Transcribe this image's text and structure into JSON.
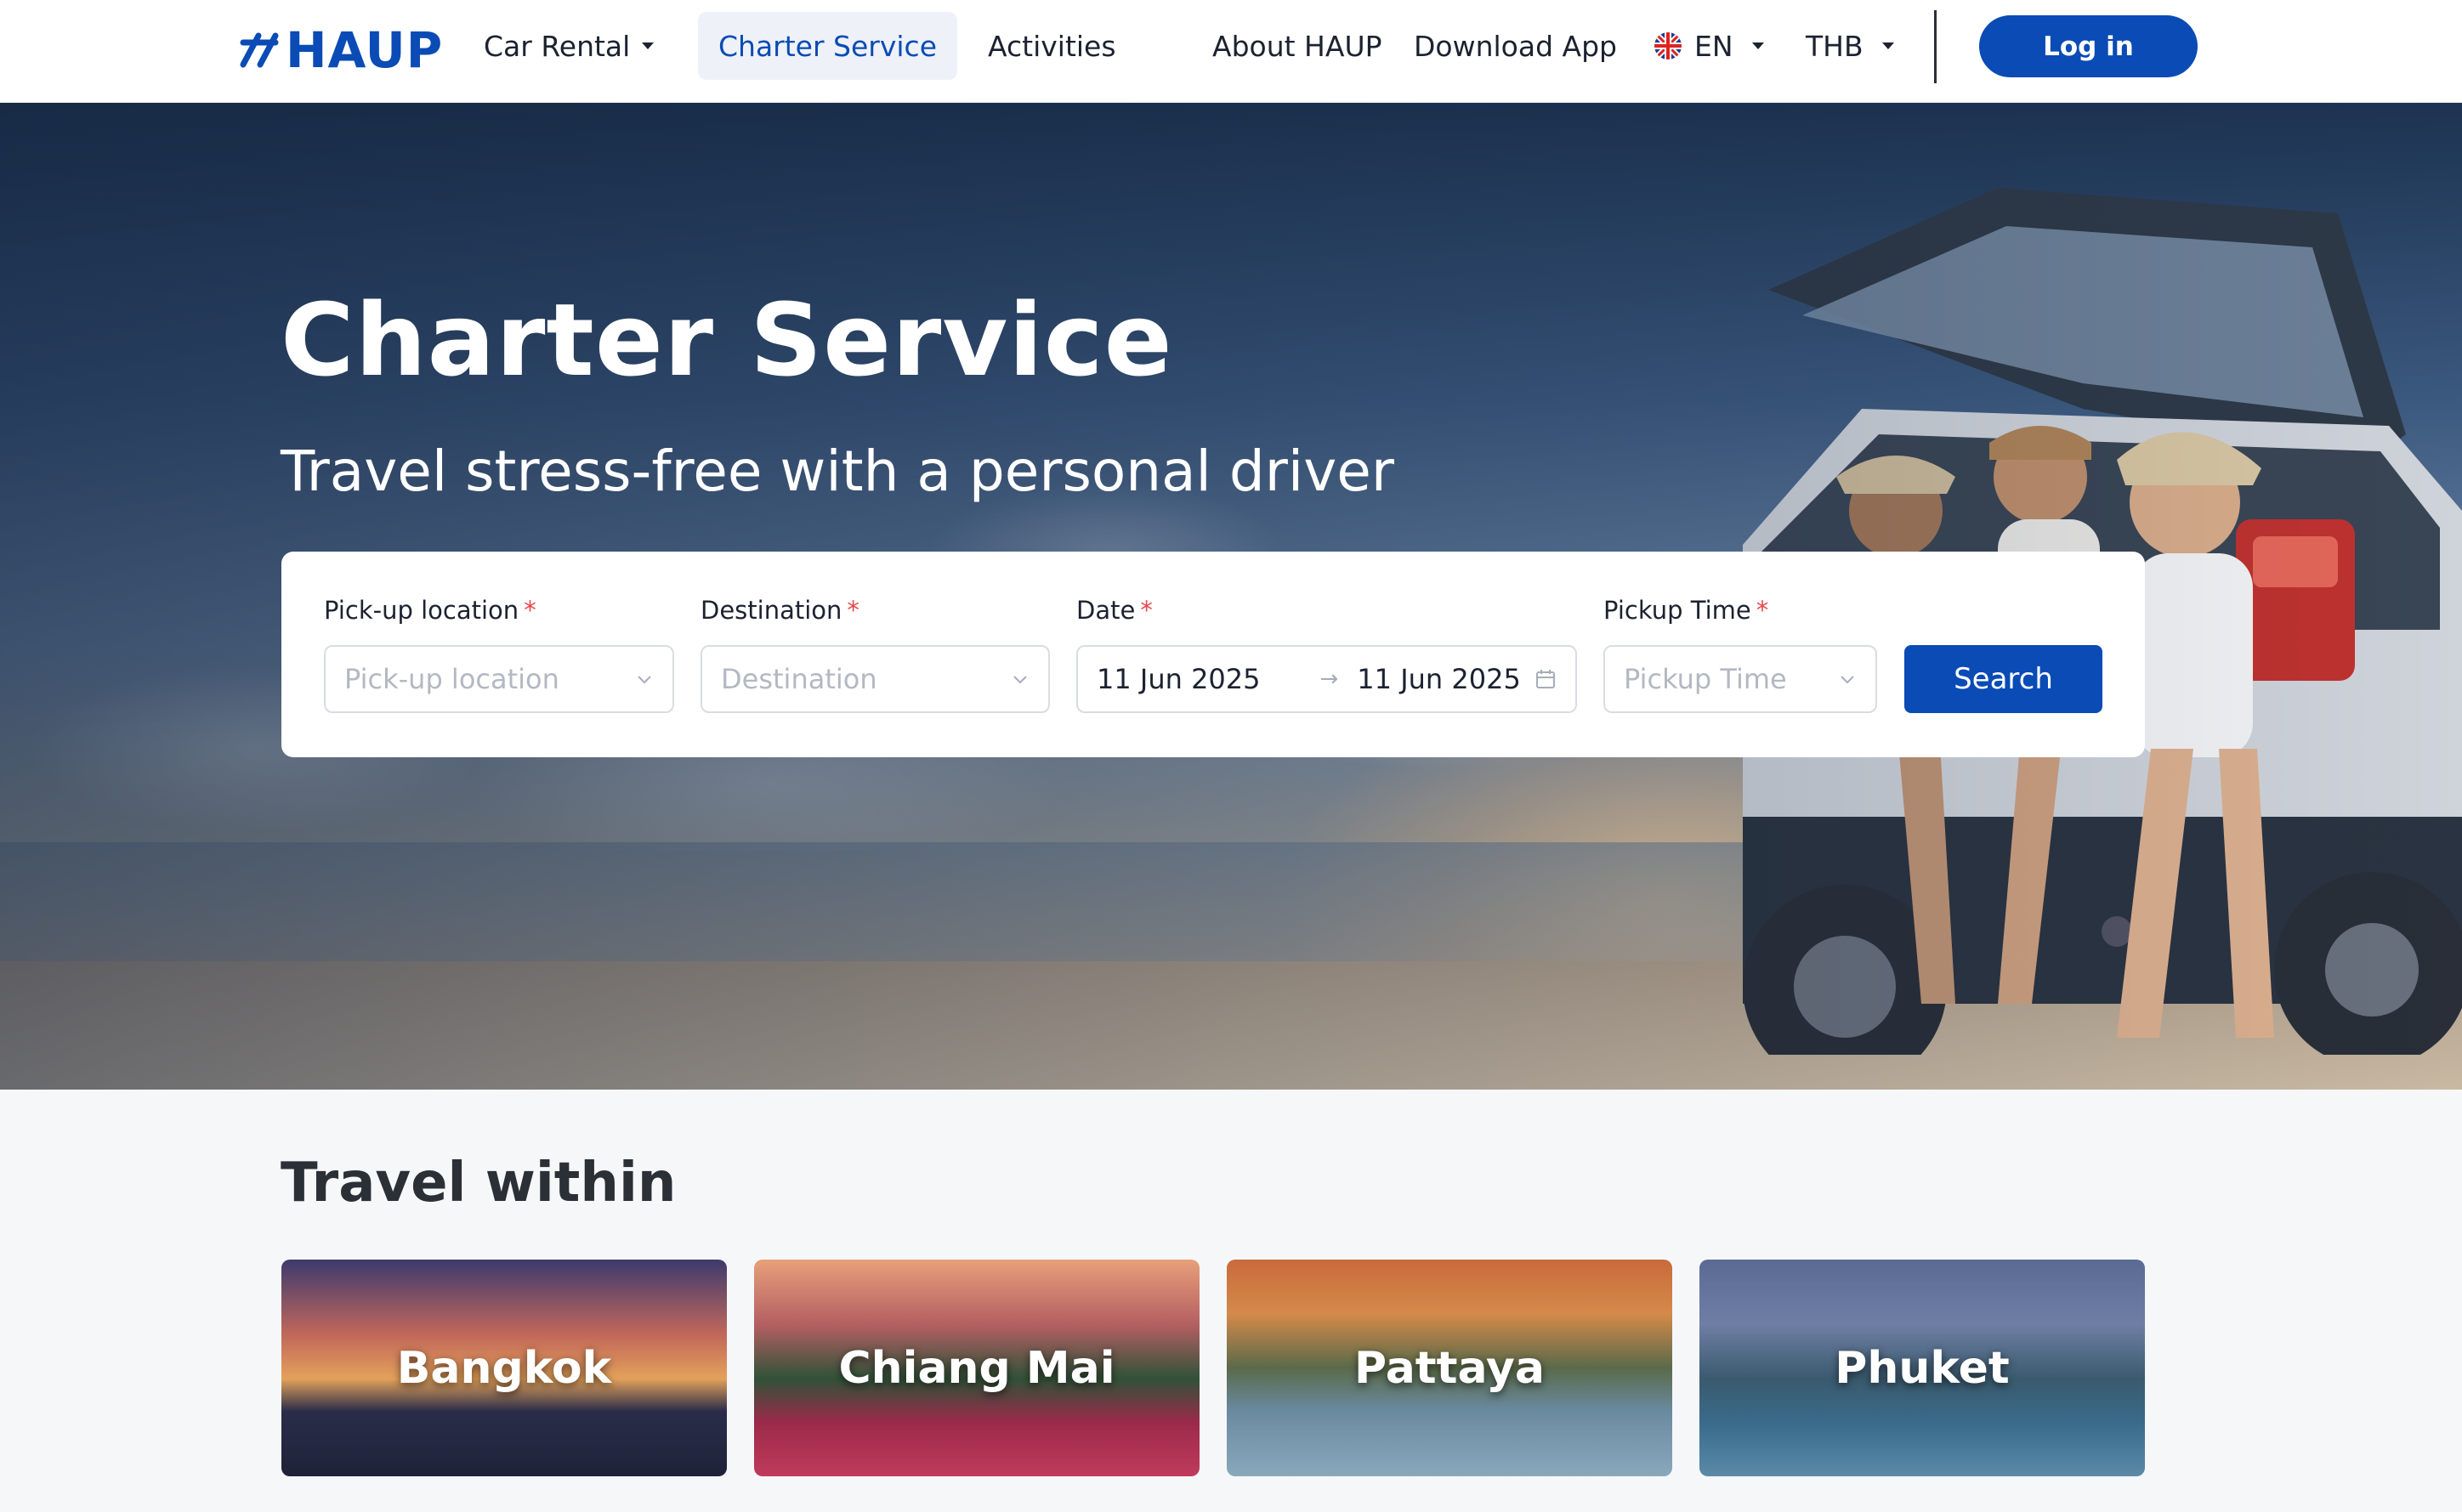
{
  "nav": {
    "brand": "HAUP",
    "items": [
      {
        "label": "Car Rental",
        "has_dropdown": true,
        "active": false
      },
      {
        "label": "Charter Service",
        "has_dropdown": false,
        "active": true
      },
      {
        "label": "Activities",
        "has_dropdown": false,
        "active": false
      },
      {
        "label": "About HAUP",
        "has_dropdown": false,
        "active": false
      },
      {
        "label": "Download App",
        "has_dropdown": false,
        "active": false
      }
    ],
    "language": {
      "label": "EN",
      "icon": "uk-flag-icon"
    },
    "currency": {
      "label": "THB"
    },
    "login_label": "Log in",
    "accent_color": "#0a4bb5"
  },
  "hero": {
    "title": "Charter Service",
    "subtitle": "Travel stress-free with a personal driver"
  },
  "search": {
    "pickup": {
      "label": "Pick-up location",
      "required_mark": "*",
      "placeholder": "Pick-up location"
    },
    "destination": {
      "label": "Destination",
      "required_mark": "*",
      "placeholder": "Destination"
    },
    "date": {
      "label": "Date",
      "required_mark": "*",
      "start": "11 Jun 2025",
      "end": "11 Jun 2025",
      "separator": "→"
    },
    "time": {
      "label": "Pickup Time",
      "required_mark": "*",
      "placeholder": "Pickup Time"
    },
    "button_label": "Search"
  },
  "travel": {
    "title": "Travel within",
    "cities": [
      {
        "name": "Bangkok"
      },
      {
        "name": "Chiang Mai"
      },
      {
        "name": "Pattaya"
      },
      {
        "name": "Phuket"
      }
    ]
  }
}
